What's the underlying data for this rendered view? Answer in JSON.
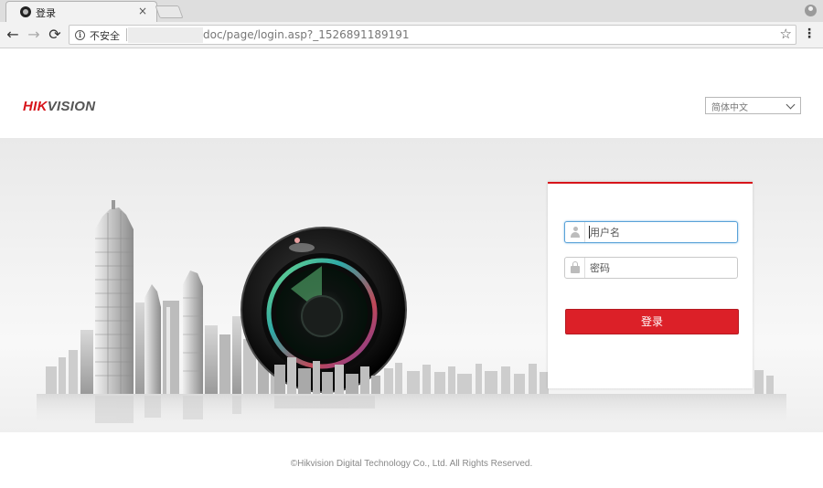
{
  "browser": {
    "tab_title": "登录",
    "tab_close": "×",
    "insecure_label": "不安全",
    "url": "doc/page/login.asp?_1526891189191",
    "back_glyph": "←",
    "forward_glyph": "→",
    "reload_glyph": "⟳",
    "star_glyph": "☆",
    "menu_glyph": "⋮",
    "info_glyph": "i"
  },
  "header": {
    "logo_hik": "HIK",
    "logo_vision": "VISION",
    "language": "简体中文"
  },
  "login": {
    "username_placeholder": "用户名",
    "password_placeholder": "密码",
    "submit_label": "登录"
  },
  "footer": {
    "copyright": "©Hikvision Digital Technology Co., Ltd. All Rights Reserved."
  },
  "colors": {
    "brand_red": "#d7141a",
    "focus_blue": "#5aa2d8"
  },
  "icons": {
    "tab": "favicon-icon",
    "username": "user-icon",
    "password": "lock-icon",
    "language": "chevron-down-icon"
  }
}
